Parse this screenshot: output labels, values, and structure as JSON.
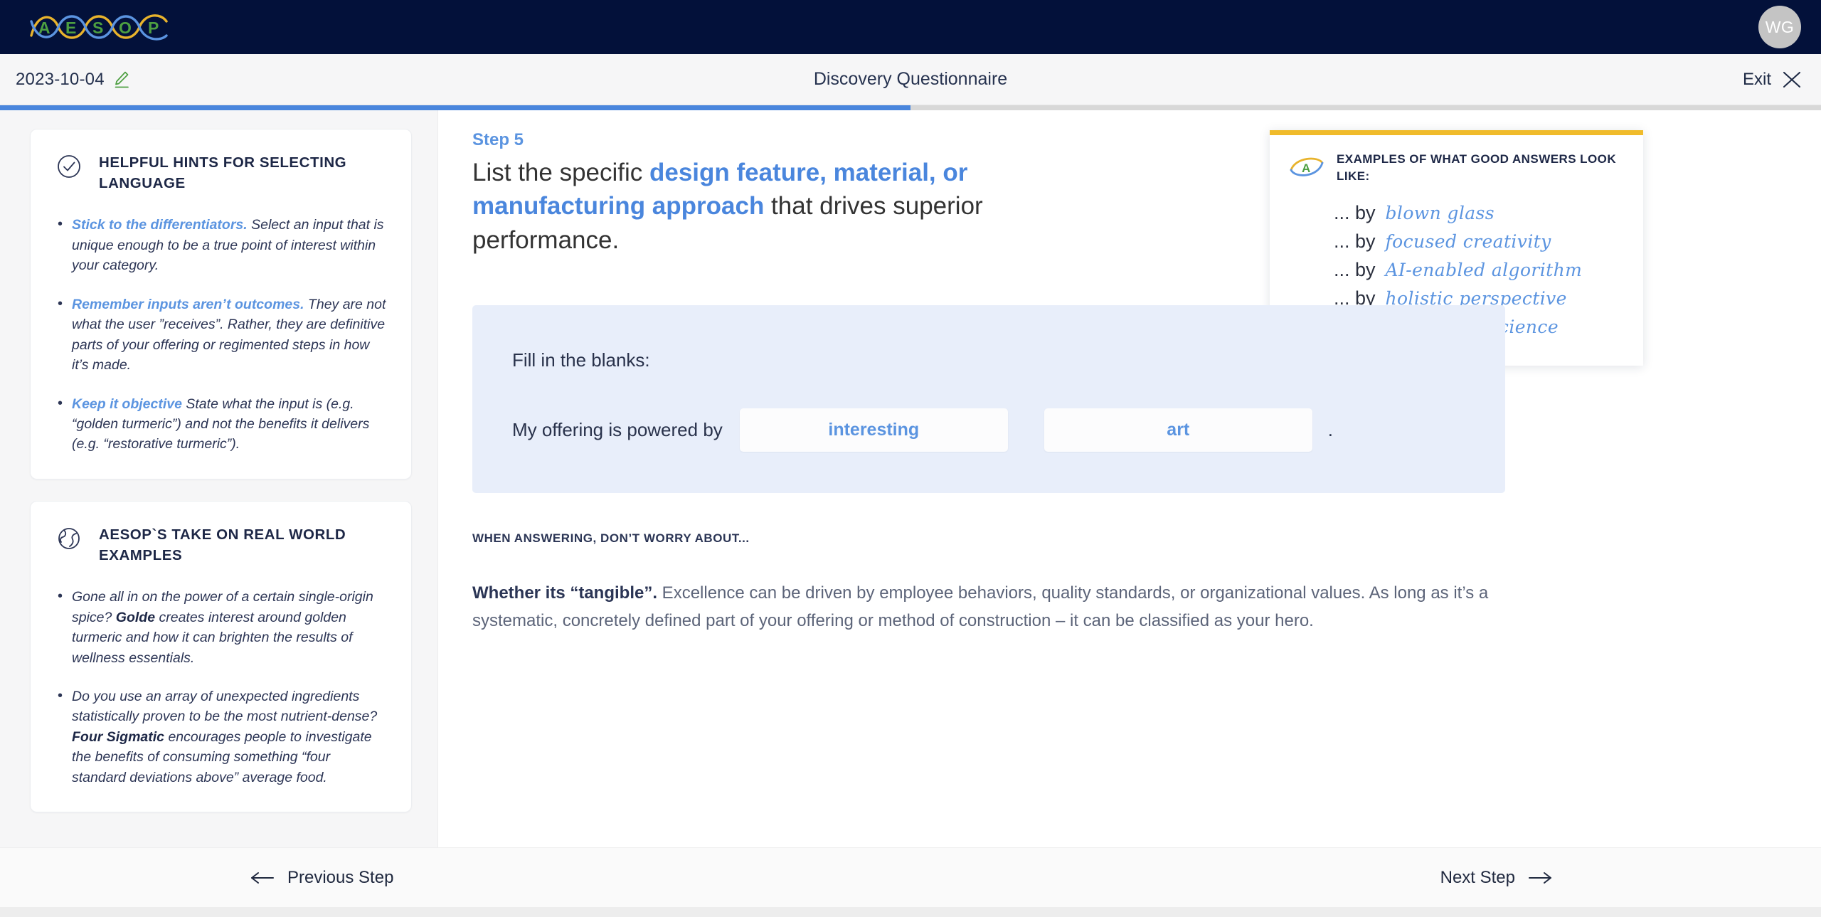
{
  "brand": {
    "logo_text": "AESOP",
    "logo_letters": [
      "A",
      "E",
      "S",
      "O",
      "P"
    ]
  },
  "topbar": {
    "avatar_initials": "WG"
  },
  "subheader": {
    "date": "2023-10-04",
    "edit_icon": "pencil-icon",
    "title": "Discovery Questionnaire",
    "exit_label": "Exit",
    "close_icon": "close-icon"
  },
  "progress": {
    "percent": 50
  },
  "sidebar": {
    "cards": [
      {
        "icon": "check-circle-icon",
        "title": "HELPFUL HINTS FOR SELECTING LANGUAGE",
        "bullets": [
          {
            "lead": "Stick to the differentiators.",
            "text": " Select an input that is unique enough to be a true point of interest within your category."
          },
          {
            "lead": "Remember inputs aren’t outcomes.",
            "text": " They are not what the user ”receives”. Rather, they are definitive parts of your offering or regimented steps in how it’s made."
          },
          {
            "lead": "Keep it objective",
            "text": " State what the input is (e.g. “golden turmeric”) and not the benefits it delivers (e.g. “restorative turmeric”)."
          }
        ]
      },
      {
        "icon": "globe-icon",
        "title": "AESOP`S TAKE ON REAL WORLD EXAMPLES",
        "bullets": [
          {
            "pre": "Gone all in on the power of a certain single-origin spice? ",
            "bold": "Golde",
            "post": " creates interest around golden turmeric and how it can brighten the results of wellness essentials."
          },
          {
            "pre": "Do you use an array of unexpected ingredients statistically proven to be the most nutrient-dense? ",
            "bold": "Four Sigmatic",
            "post": " encourages people to investigate the benefits of consuming something “four standard deviations above” average food."
          }
        ]
      }
    ]
  },
  "main": {
    "step_label": "Step 5",
    "question_pre": "List the specific ",
    "question_highlight": "design feature, material, or manufacturing approach",
    "question_post": " that drives superior performance.",
    "examples": {
      "icon": "aesop-eye-icon",
      "title": "EXAMPLES OF WHAT GOOD ANSWERS LOOK LIKE:",
      "items": [
        {
          "prefix": "... by",
          "value": "blown glass"
        },
        {
          "prefix": "... by",
          "value": "focused creativity"
        },
        {
          "prefix": "... by",
          "value": "AI-enabled  algorithm"
        },
        {
          "prefix": "... by",
          "value": "holistic perspective"
        },
        {
          "prefix": "... by",
          "value": "behavioral science"
        }
      ]
    },
    "blanks": {
      "label": "Fill in the blanks:",
      "prefix": "My offering is powered by",
      "input1_value": "interesting",
      "input1_placeholder": "",
      "input2_value": "art",
      "input2_placeholder": "",
      "period": "."
    },
    "note": {
      "heading": "WHEN ANSWERING, DON’T WORRY ABOUT...",
      "bold": "Whether its “tangible”.",
      "text": " Excellence can be driven by employee behaviors, quality standards, or organizational values. As long as it’s a systematic, concretely defined part of your offering or method of construction – it can be classified as your hero."
    }
  },
  "footer": {
    "previous_label": "Previous Step",
    "previous_icon": "arrow-left-icon",
    "next_label": "Next Step",
    "next_icon": "arrow-right-icon"
  },
  "colors": {
    "navy": "#03113a",
    "accent_blue": "#4a86dd",
    "light_blue_panel": "#e8eefa",
    "gold": "#f0bb2b",
    "green": "#4d9f41",
    "text_dark": "#1d2746"
  }
}
